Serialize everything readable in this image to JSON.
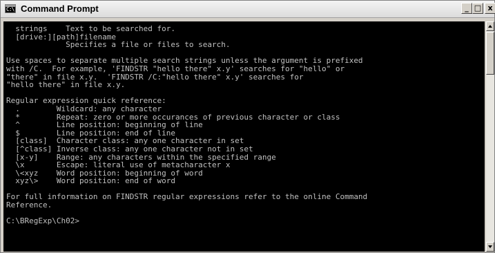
{
  "window": {
    "title": "Command Prompt",
    "icon_text": "C:\\",
    "controls": {
      "minimize": "_",
      "maximize": "□",
      "close": "x"
    }
  },
  "console": {
    "lines": [
      "  strings    Text to be searched for.",
      "  [drive:][path]filename",
      "             Specifies a file or files to search.",
      "",
      "Use spaces to separate multiple search strings unless the argument is prefixed",
      "with /C.  For example, 'FINDSTR \"hello there\" x.y' searches for \"hello\" or",
      "\"there\" in file x.y.  'FINDSTR /C:\"hello there\" x.y' searches for",
      "\"hello there\" in file x.y.",
      "",
      "Regular expression quick reference:",
      "  .        Wildcard: any character",
      "  *        Repeat: zero or more occurances of previous character or class",
      "  ^        Line position: beginning of line",
      "  $        Line position: end of line",
      "  [class]  Character class: any one character in set",
      "  [^class] Inverse class: any one character not in set",
      "  [x-y]    Range: any characters within the specified range",
      "  \\x       Escape: literal use of metacharacter x",
      "  \\<xyz    Word position: beginning of word",
      "  xyz\\>    Word position: end of word",
      "",
      "For full information on FINDSTR regular expressions refer to the online Command",
      "Reference.",
      "",
      "C:\\BRegExp\\Ch02>"
    ]
  },
  "colors": {
    "console_background": "#000000",
    "console_text": "#c0c0c0",
    "chrome": "#d4d0c8"
  }
}
